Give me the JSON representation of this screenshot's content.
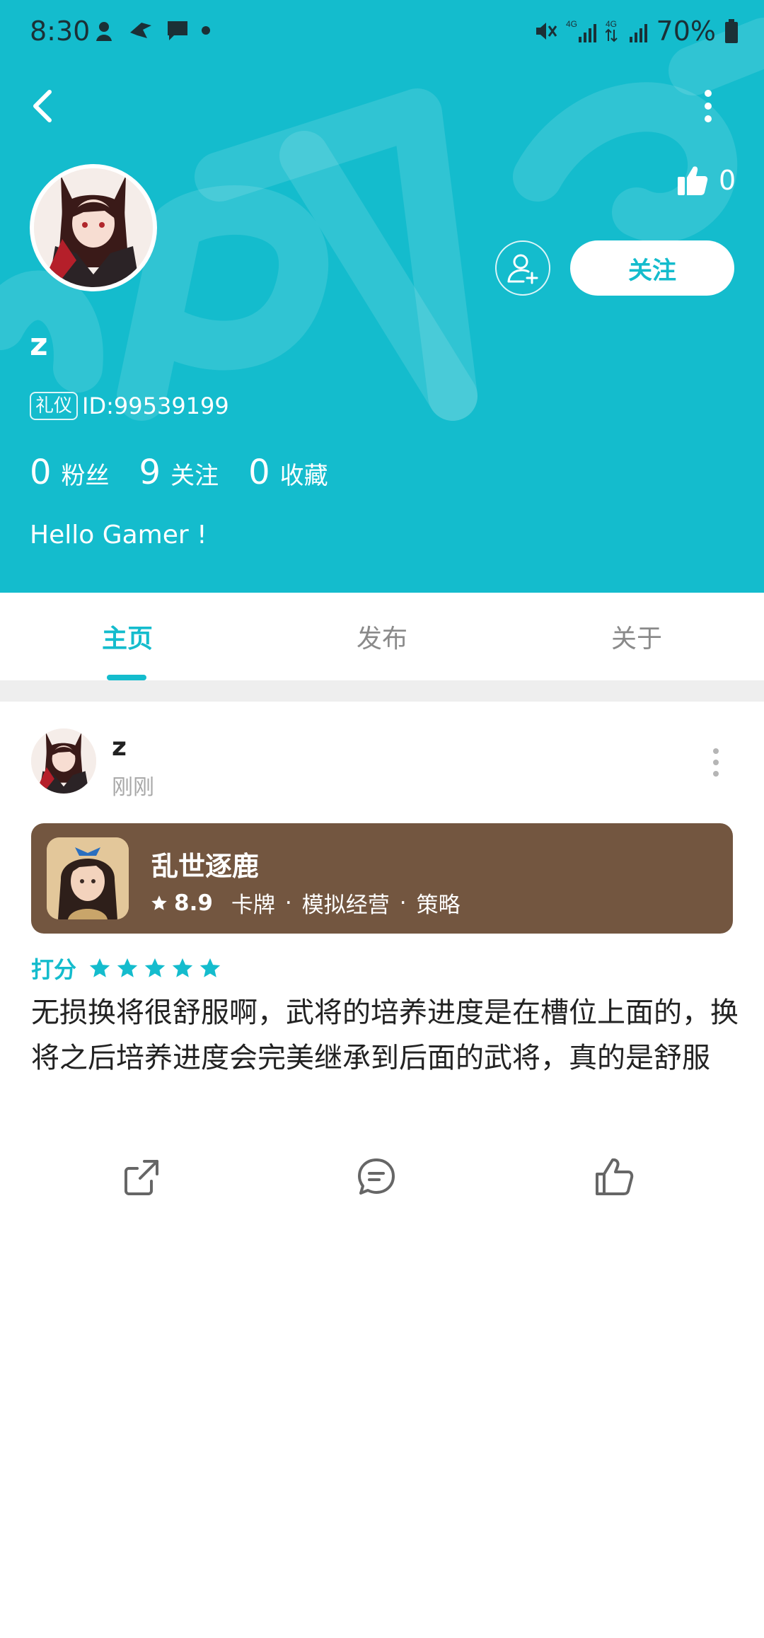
{
  "status_bar": {
    "time": "8:30",
    "battery": "70%"
  },
  "profile": {
    "username": "z",
    "badge": "礼仪",
    "id_text": "ID:99539199",
    "likes": "0",
    "follow_label": "关注",
    "bio": "Hello Gamer !",
    "stats": [
      {
        "count": "0",
        "label": "粉丝"
      },
      {
        "count": "9",
        "label": "关注"
      },
      {
        "count": "0",
        "label": "收藏"
      }
    ]
  },
  "tabs": [
    {
      "label": "主页",
      "active": true
    },
    {
      "label": "发布",
      "active": false
    },
    {
      "label": "关于",
      "active": false
    }
  ],
  "post": {
    "author": "z",
    "time": "刚刚",
    "game": {
      "title": "乱世逐鹿",
      "score": "8.9",
      "tags": [
        "卡牌",
        "模拟经营",
        "策略"
      ]
    },
    "rating_label": "打分",
    "stars": 5,
    "review": "无损换将很舒服啊，武将的培养进度是在槽位上面的，换将之后培养进度会完美继承到后面的武将，真的是舒服"
  },
  "colors": {
    "accent": "#14bccd",
    "game_card": "#735640",
    "divider": "#eeeeee"
  },
  "icons": [
    "back-icon",
    "more-icon",
    "thumbs-up-icon",
    "add-friend-icon",
    "star-icon",
    "share-icon",
    "comment-icon",
    "like-icon"
  ]
}
